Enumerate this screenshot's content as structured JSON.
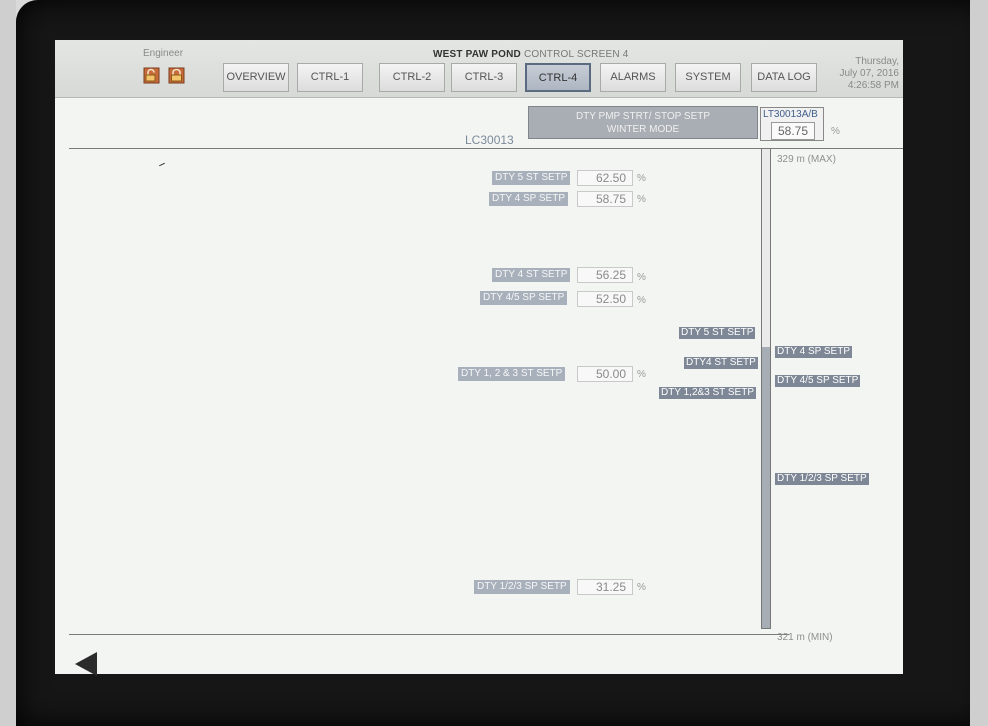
{
  "header": {
    "user_role": "Engineer",
    "title_bold": "WEST PAW POND",
    "title_rest": " CONTROL SCREEN 4",
    "datetime": {
      "day": "Thursday,",
      "date": "July 07, 2016",
      "time": "4:26:58 PM"
    },
    "tabs": [
      {
        "label": "OVERVIEW"
      },
      {
        "label": "CTRL-1"
      },
      {
        "label": "CTRL-2"
      },
      {
        "label": "CTRL-3"
      },
      {
        "label": "CTRL-4",
        "active": true
      },
      {
        "label": "ALARMS"
      },
      {
        "label": "SYSTEM"
      },
      {
        "label": "DATA LOG"
      }
    ]
  },
  "panel": {
    "setp_title_line1": "DTY PMP STRT/ STOP SETP",
    "setp_title_line2": "WINTER MODE",
    "controller": "LC30013",
    "transmitter": {
      "tag": "LT30013A/B",
      "value": "58.75",
      "unit": "%"
    }
  },
  "setpoints": [
    {
      "label": "DTY 5 ST SETP",
      "value": "62.50",
      "unit": "%"
    },
    {
      "label": "DTY 4 SP SETP",
      "value": "58.75",
      "unit": "%"
    },
    {
      "label": "DTY 4 ST SETP",
      "value": "56.25",
      "unit": "%"
    },
    {
      "label": "DTY 4/5 SP SETP",
      "value": "52.50",
      "unit": "%"
    },
    {
      "label": "DTY 1, 2 & 3 ST SETP",
      "value": "50.00",
      "unit": "%"
    },
    {
      "label": "DTY 1/2/3 SP SETP",
      "value": "31.25",
      "unit": "%"
    }
  ],
  "level_scale": {
    "max_label": "329 m (MAX)",
    "min_label": "321 m (MIN)",
    "current_level_pct": 58.75
  },
  "markers_left": [
    "DTY 5 ST SETP",
    "DTY4 ST SETP",
    "DTY 1,2&3 ST SETP"
  ],
  "markers_right": [
    "DTY 4 SP SETP",
    "DTY 4/5 SP SETP",
    "DTY 1/2/3 SP SETP"
  ],
  "icons": {
    "unlock": "unlock-icon",
    "lock": "lock-icon",
    "back": "back-arrow-icon"
  }
}
